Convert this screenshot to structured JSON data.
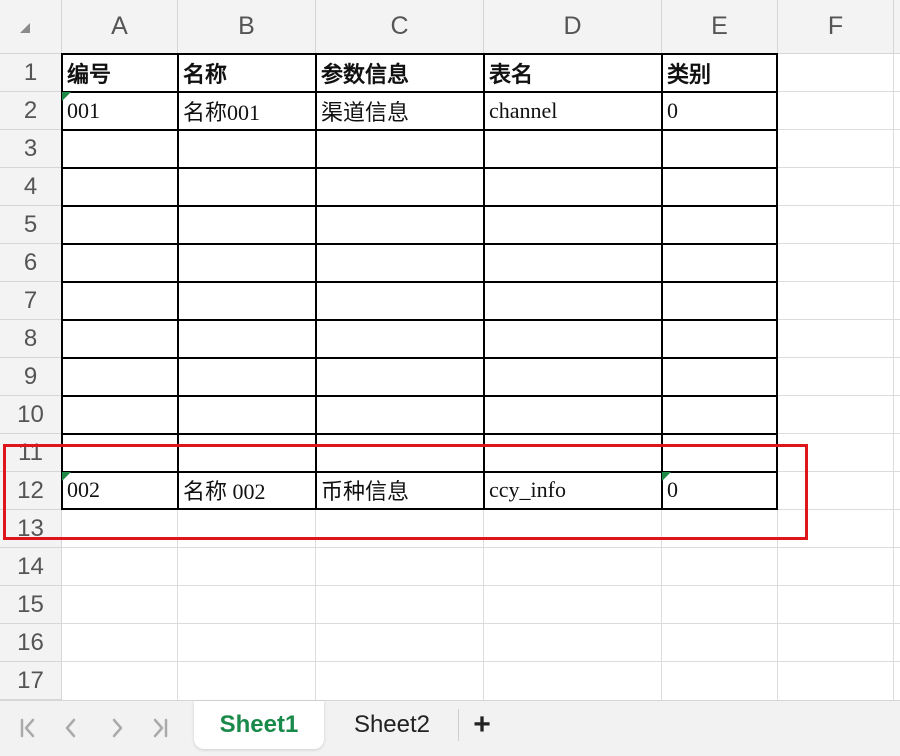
{
  "columns": [
    "A",
    "B",
    "C",
    "D",
    "E",
    "F"
  ],
  "rows": [
    "1",
    "2",
    "3",
    "4",
    "5",
    "6",
    "7",
    "8",
    "9",
    "10",
    "11",
    "12",
    "13",
    "14",
    "15",
    "16",
    "17"
  ],
  "table": {
    "header": [
      "编号",
      "名称",
      "参数信息",
      "表名",
      "类别"
    ],
    "row2": [
      "001",
      "名称001",
      "渠道信息",
      "channel",
      "0"
    ],
    "row12": [
      "002",
      "名称 002",
      "币种信息",
      "ccy_info",
      "0"
    ]
  },
  "sheets": {
    "active": "Sheet1",
    "other": "Sheet2",
    "add": "+"
  },
  "colors": {
    "highlight": "#e0141b",
    "active_tab": "#1a8a4a",
    "error_marker": "#1e8a45"
  }
}
